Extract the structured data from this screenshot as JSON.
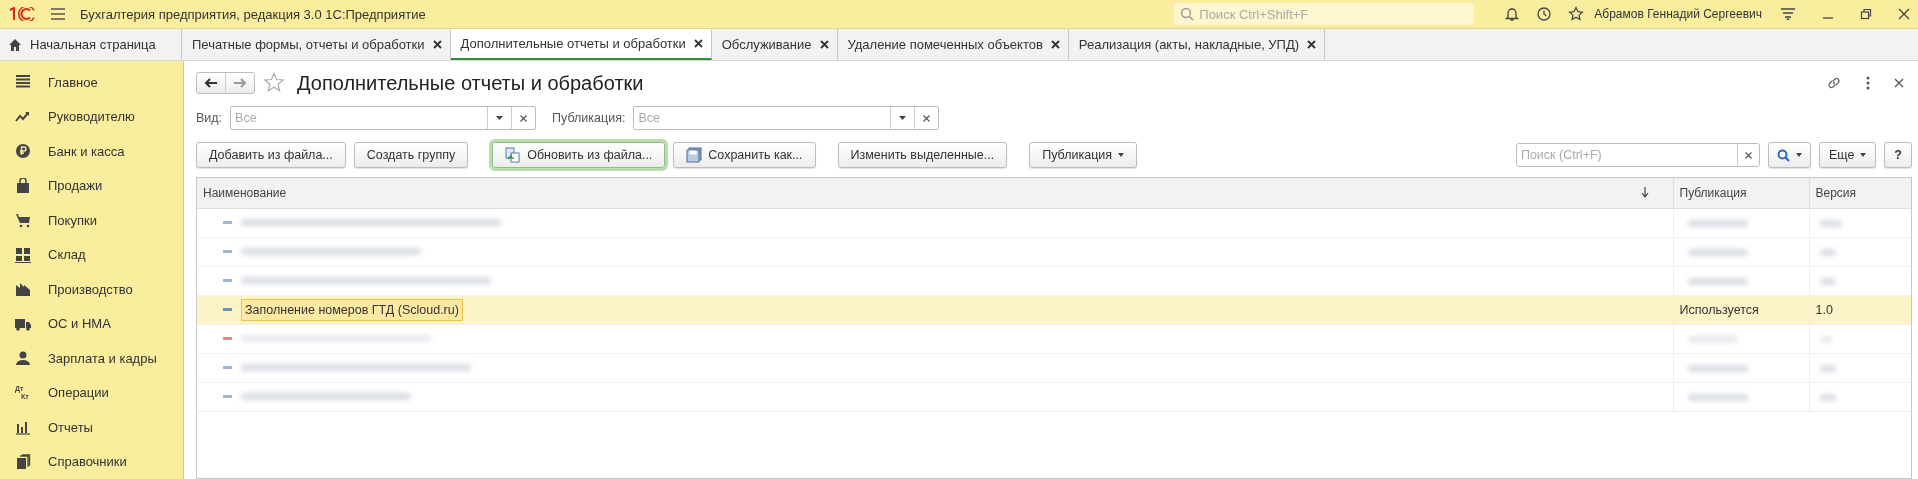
{
  "window": {
    "title": "Бухгалтерия предприятия, редакция 3.0 1С:Предприятие",
    "search_placeholder": "Поиск Ctrl+Shift+F",
    "user": "Абрамов Геннадий Сергеевич"
  },
  "tabs": [
    {
      "label": "Начальная страница",
      "kind": "home",
      "selected": false
    },
    {
      "label": "Печатные формы, отчеты и обработки",
      "kind": "closable",
      "selected": false
    },
    {
      "label": "Дополнительные отчеты и обработки",
      "kind": "closable",
      "selected": true
    },
    {
      "label": "Обслуживание",
      "kind": "closable",
      "selected": false
    },
    {
      "label": "Удаление помеченных объектов",
      "kind": "closable",
      "selected": false
    },
    {
      "label": "Реализация (акты, накладные, УПД)",
      "kind": "closable",
      "selected": false
    }
  ],
  "sidebar": {
    "items": [
      {
        "label": "Главное",
        "kind": "lines"
      },
      {
        "label": "Руководителю",
        "kind": "trend"
      },
      {
        "label": "Банк и касса",
        "kind": "ruble"
      },
      {
        "label": "Продажи",
        "kind": "bag"
      },
      {
        "label": "Покупки",
        "kind": "cart"
      },
      {
        "label": "Склад",
        "kind": "grid"
      },
      {
        "label": "Производство",
        "kind": "factory"
      },
      {
        "label": "ОС и НМА",
        "kind": "truck"
      },
      {
        "label": "Зарплата и кадры",
        "kind": "person"
      },
      {
        "label": "Операции",
        "kind": "dtkt",
        "marks": [
          "Дт",
          "Кт"
        ]
      },
      {
        "label": "Отчеты",
        "kind": "bars"
      },
      {
        "label": "Справочники",
        "kind": "books"
      }
    ]
  },
  "form": {
    "title": "Дополнительные отчеты и обработки",
    "filters": [
      {
        "label": "Вид:",
        "placeholder": "Все"
      },
      {
        "label": "Публикация:",
        "placeholder": "Все"
      }
    ],
    "buttons": [
      {
        "label": "Добавить из файла...",
        "kind": "plain",
        "focused": false
      },
      {
        "label": "Создать группу",
        "kind": "plain",
        "focused": false
      },
      {
        "label": "Обновить из файла...",
        "kind": "update",
        "focused": true
      },
      {
        "label": "Сохранить как...",
        "kind": "save",
        "focused": false
      },
      {
        "label": "Изменить выделенные...",
        "kind": "plain",
        "focused": false
      },
      {
        "label": "Публикация",
        "kind": "dropdown",
        "focused": false
      }
    ],
    "search": {
      "placeholder": "Поиск (Ctrl+F)"
    },
    "right_buttons": [
      {
        "label": "Еще",
        "kind": "dropdown"
      },
      {
        "label": "?",
        "kind": "plain"
      }
    ],
    "table": {
      "columns": [
        {
          "label": "Наименование",
          "sorted": true
        },
        {
          "label": "Публикация",
          "sorted": false
        },
        {
          "label": "Версия",
          "sorted": false
        }
      ],
      "rows": [
        {
          "kind": "blurred",
          "color": "#9fb4d8",
          "selected": false
        },
        {
          "kind": "blurred",
          "color": "#9fb4d8",
          "selected": false
        },
        {
          "kind": "blurred",
          "color": "#9fb4d8",
          "selected": false
        },
        {
          "kind": "item",
          "color": "#6f8fb8",
          "name": "Заполнение номеров ГТД (Scloud.ru)",
          "publication": "Используется",
          "version": "1.0",
          "selected": true
        },
        {
          "kind": "blurred",
          "color": "#e08a8a",
          "selected": false
        },
        {
          "kind": "blurred",
          "color": "#9fb4d8",
          "selected": false
        },
        {
          "kind": "blurred",
          "color": "#9fb4d8",
          "selected": false
        }
      ]
    }
  }
}
